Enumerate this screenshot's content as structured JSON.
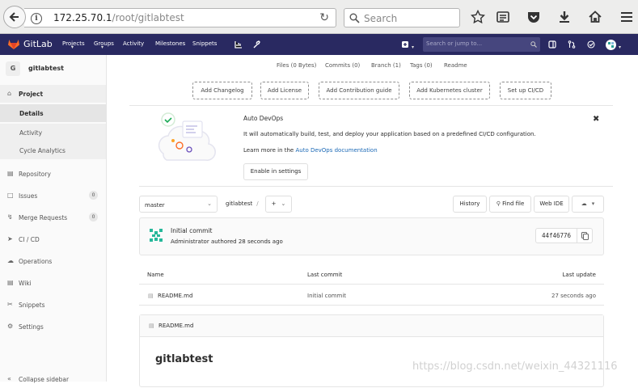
{
  "browser": {
    "url_host": "172.25.70.1",
    "url_path": "/root/gitlabtest",
    "search_placeholder": "Search"
  },
  "navbar": {
    "brand": "GitLab",
    "links": [
      "Projects",
      "Groups",
      "Activity",
      "Milestones",
      "Snippets"
    ],
    "search_placeholder": "Search or jump to..."
  },
  "sidebar": {
    "avatar_letter": "G",
    "project_name": "gitlabtest",
    "items": [
      {
        "label": "Project",
        "icon": "home-icon"
      },
      {
        "label": "Details"
      },
      {
        "label": "Activity"
      },
      {
        "label": "Cycle Analytics"
      },
      {
        "label": "Repository",
        "icon": "book-icon"
      },
      {
        "label": "Issues",
        "icon": "issues-icon",
        "count": "0"
      },
      {
        "label": "Merge Requests",
        "icon": "merge-request-icon",
        "count": "0"
      },
      {
        "label": "CI / CD",
        "icon": "rocket-icon"
      },
      {
        "label": "Operations",
        "icon": "cloud-gear-icon"
      },
      {
        "label": "Wiki",
        "icon": "wiki-icon"
      },
      {
        "label": "Snippets",
        "icon": "scissors-icon"
      },
      {
        "label": "Settings",
        "icon": "gear-icon"
      }
    ],
    "collapse_label": "Collapse sidebar"
  },
  "stats": [
    "Files (0 Bytes)",
    "Commits (0)",
    "Branch (1)",
    "Tags (0)",
    "Readme"
  ],
  "add_buttons": [
    "Add Changelog",
    "Add License",
    "Add Contribution guide",
    "Add Kubernetes cluster",
    "Set up CI/CD"
  ],
  "devops": {
    "title": "Auto DevOps",
    "description": "It will automatically build, test, and deploy your application based on a predefined CI/CD configuration.",
    "learn_prefix": "Learn more in the ",
    "learn_link": "Auto DevOps documentation",
    "enable_button": "Enable in settings"
  },
  "repo_toolbar": {
    "branch": "master",
    "project": "gitlabtest",
    "separator": "/",
    "add_symbol": "+",
    "buttons": [
      "History",
      "Find file",
      "Web IDE"
    ]
  },
  "commit": {
    "title": "Initial commit",
    "meta": "Administrator authored 28 seconds ago",
    "sha": "44f46776"
  },
  "files_table": {
    "headers": [
      "Name",
      "Last commit",
      "Last update"
    ],
    "rows": [
      {
        "name": "README.md",
        "commit": "Initial commit",
        "updated": "27 seconds ago"
      }
    ]
  },
  "readme": {
    "filename": "README.md",
    "heading": "gitlabtest"
  },
  "watermark": "https://blog.csdn.net/weixin_44321116"
}
